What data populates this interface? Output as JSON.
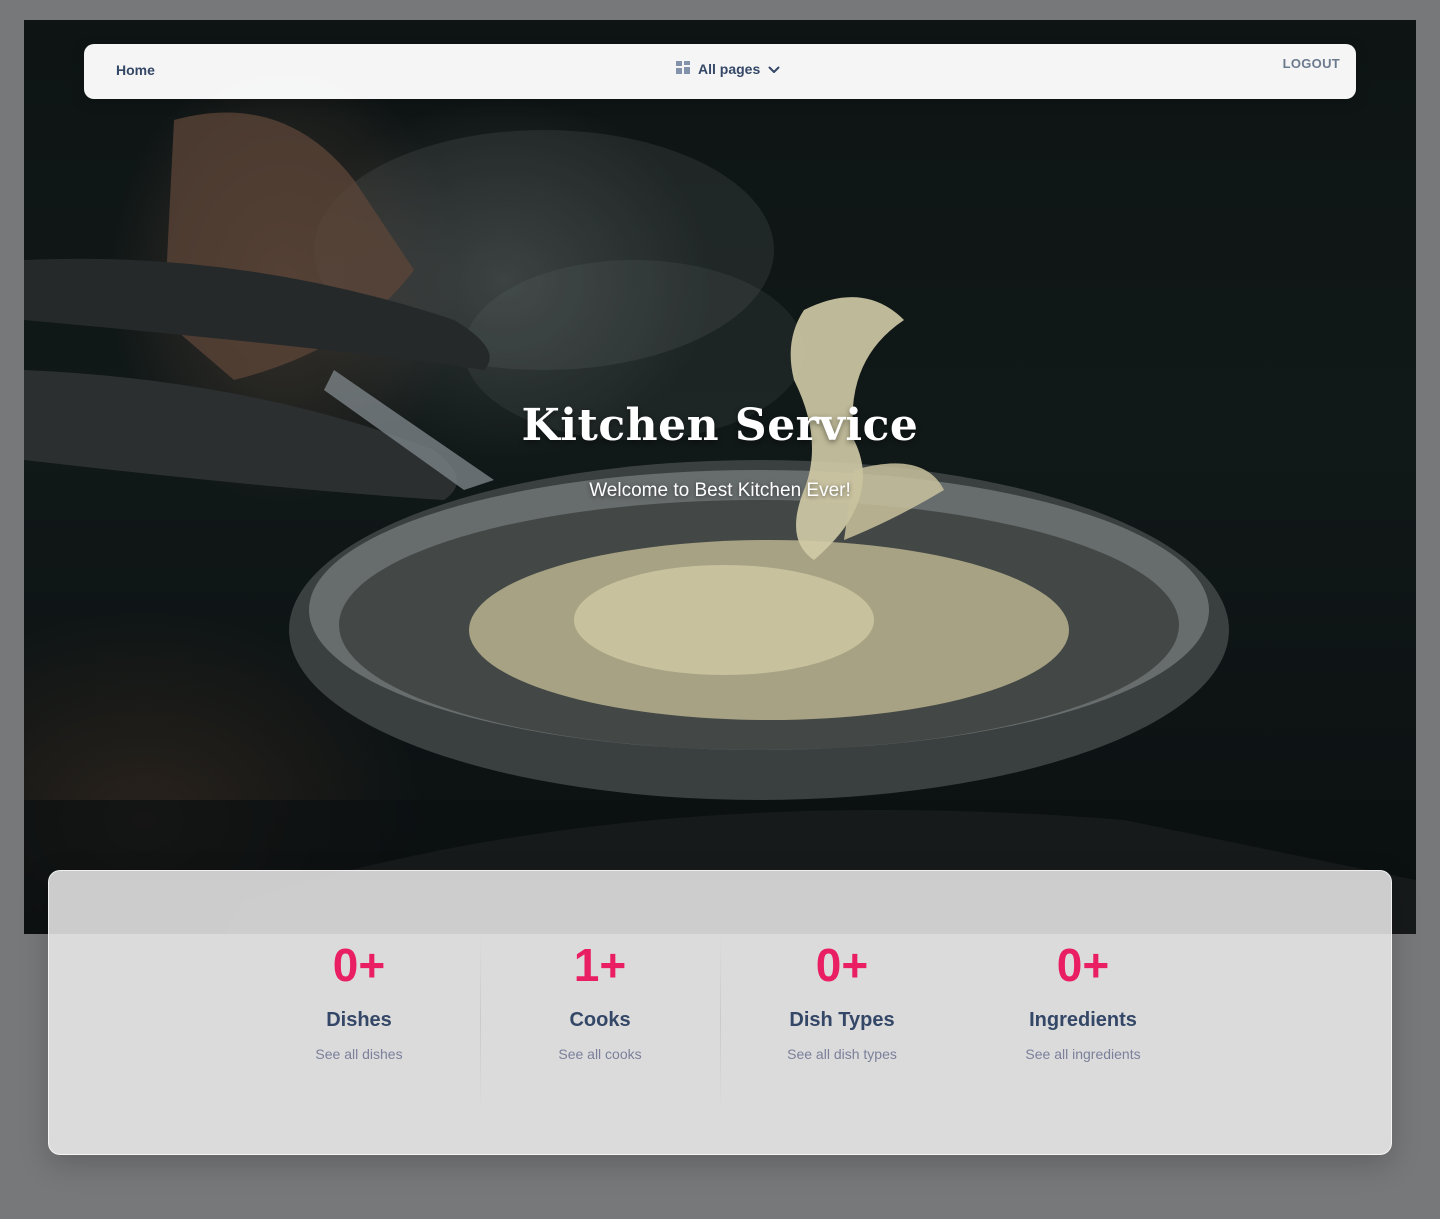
{
  "navbar": {
    "home_label": "Home",
    "pages_label": "All pages",
    "pages_icon": "dashboard-grid-icon",
    "dropdown_icon": "chevron-down-icon",
    "logout_label": "LOGOUT"
  },
  "hero": {
    "title": "Kitchen Service",
    "subtitle": "Welcome to Best Kitchen Ever!",
    "image": "pan-with-pasta-photo"
  },
  "stats": [
    {
      "value": "0+",
      "label": "Dishes",
      "link": "See all dishes"
    },
    {
      "value": "1+",
      "label": "Cooks",
      "link": "See all cooks"
    },
    {
      "value": "0+",
      "label": "Dish Types",
      "link": "See all dish types"
    },
    {
      "value": "0+",
      "label": "Ingredients",
      "link": "See all ingredients"
    }
  ],
  "colors": {
    "accent": "#e91e63",
    "heading": "#344767",
    "muted": "#7b809a",
    "page_background": "#77787a"
  }
}
